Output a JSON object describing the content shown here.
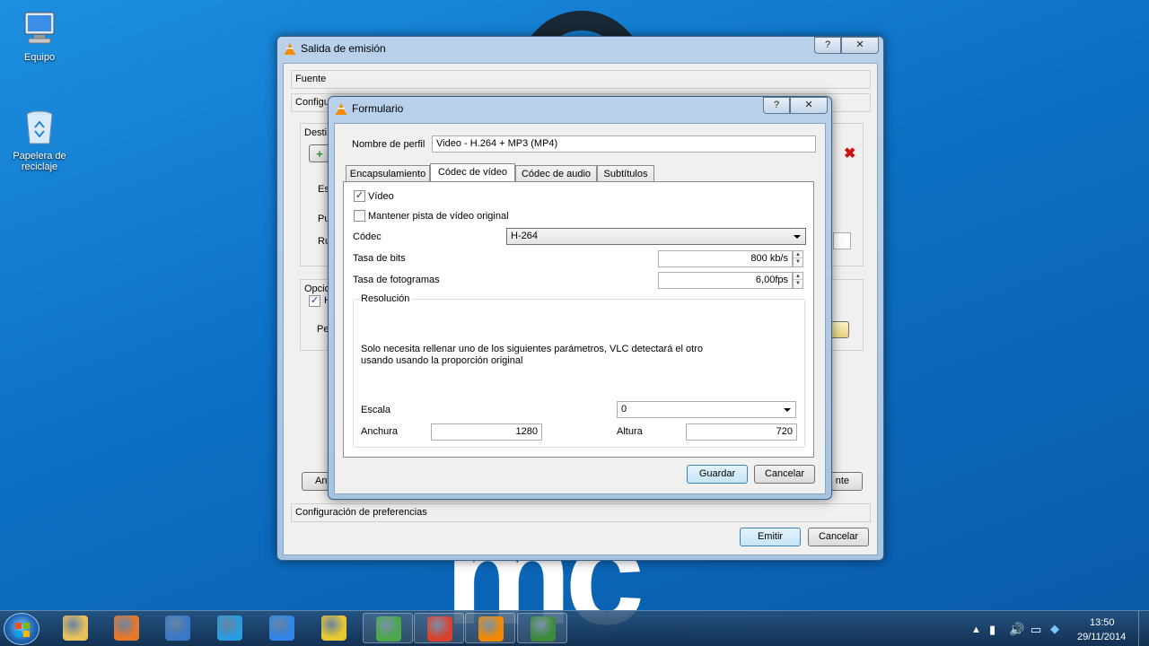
{
  "desktop": {
    "icons": [
      {
        "label": "Equipo"
      },
      {
        "label": "Papelera de reciclaje"
      }
    ],
    "background_text": "mc"
  },
  "stream_window": {
    "title": "Salida de emisión",
    "help_label": "?",
    "close_label": "✕",
    "fuente_label": "Fuente",
    "config_label": "Configur",
    "destinos_label": "Desti",
    "est_label": "Est",
    "pue_label": "Pu",
    "rut_label": "Ru",
    "opciones_label": "Opcio",
    "h_label": "H",
    "per_label": "Per",
    "prev_button": "Ant",
    "next_button": "nte",
    "preferences_label": "Configuración de preferencias",
    "emit_button": "Emitir",
    "cancel_button": "Cancelar"
  },
  "profile_dialog": {
    "title": "Formulario",
    "help_label": "?",
    "close_label": "✕",
    "profile_name_label": "Nombre de perfil",
    "profile_name_value": "Video - H.264 + MP3 (MP4)",
    "tabs": [
      {
        "label": "Encapsulamiento"
      },
      {
        "label": "Códec de vídeo"
      },
      {
        "label": "Códec de audio"
      },
      {
        "label": "Subtítulos"
      }
    ],
    "active_tab": "Códec de vídeo",
    "video_checkbox_label": "Vídeo",
    "video_checked": true,
    "keep_track_label": "Mantener pista de vídeo original",
    "keep_track_checked": false,
    "codec_label": "Códec",
    "codec_value": "H-264",
    "bitrate_label": "Tasa de bits",
    "bitrate_value": "800 kb/s",
    "framerate_label": "Tasa de fotogramas",
    "framerate_value": "6,00fps",
    "resolution_label": "Resolución",
    "resolution_note_1": "Solo necesita rellenar uno de los siguientes parámetros, VLC detectará el otro",
    "resolution_note_2": "usando usando la proporción original",
    "scale_label": "Escala",
    "scale_value": "0",
    "width_label": "Anchura",
    "width_value": "1280",
    "height_label": "Altura",
    "height_value": "720",
    "save_button": "Guardar",
    "cancel_button": "Cancelar"
  },
  "taskbar": {
    "apps": [
      {
        "name": "explorer-icon",
        "color": "#e8c15a"
      },
      {
        "name": "firefox-icon",
        "color": "#e8782a"
      },
      {
        "name": "thunderbird-icon",
        "color": "#3a78c8"
      },
      {
        "name": "internet-explorer-icon",
        "color": "#2a9ce0"
      },
      {
        "name": "dropbox-icon",
        "color": "#2f86e8"
      },
      {
        "name": "keys-icon",
        "color": "#e8c830"
      },
      {
        "name": "task-app-icon",
        "color": "#4aa84a"
      },
      {
        "name": "chrome-icon",
        "color": "#d84030"
      },
      {
        "name": "vlc-icon",
        "color": "#f08a00"
      },
      {
        "name": "monitor-icon",
        "color": "#3d8a3d"
      }
    ],
    "time": "13:50",
    "date": "29/11/2014"
  }
}
